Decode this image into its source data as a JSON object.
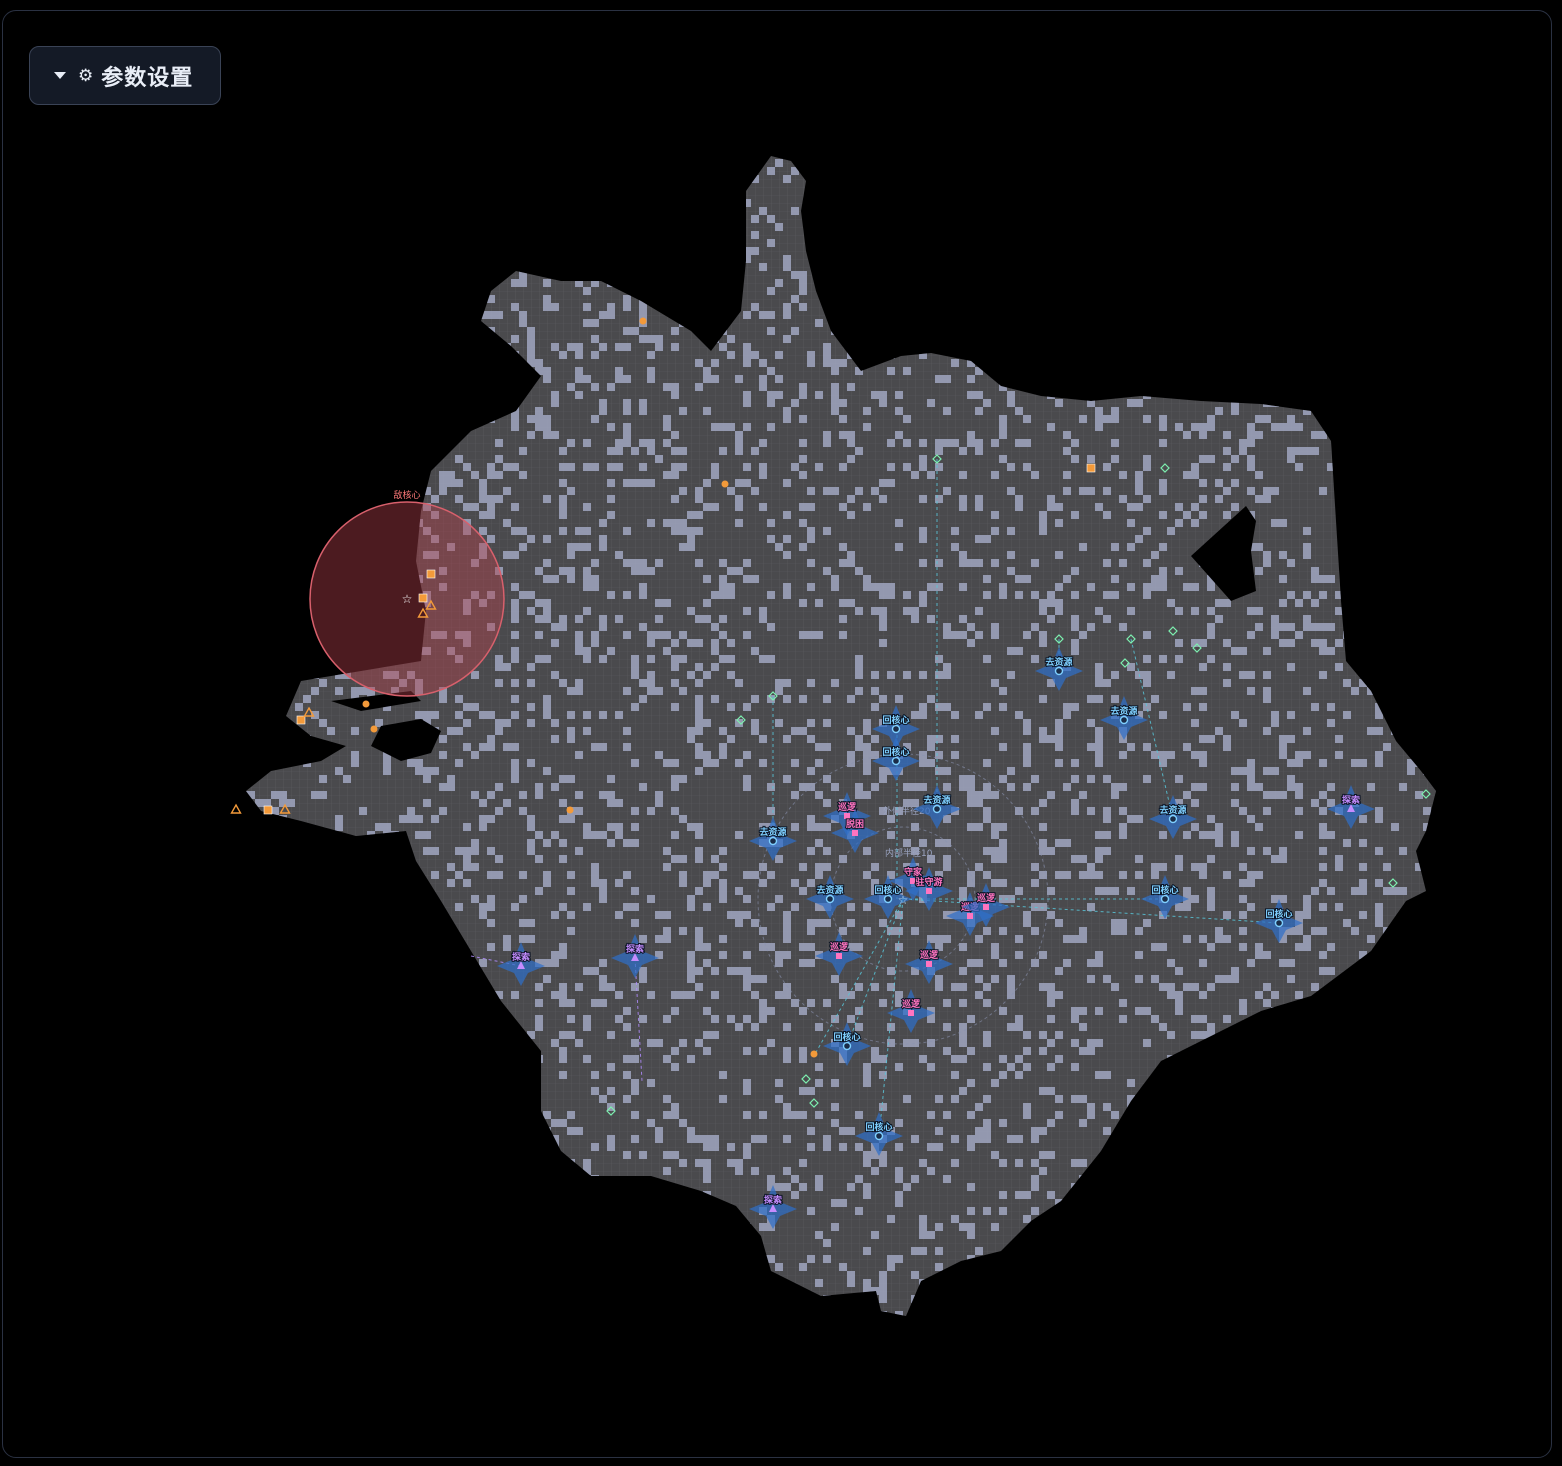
{
  "toolbar": {
    "settings_label": "参数设置",
    "gear_icon": "gear-icon",
    "caret_icon": "caret-down-icon"
  },
  "colors": {
    "background": "#000000",
    "floor": "#4a4a4d",
    "floor_grid": "#5c5c60",
    "wall_block": "#a4a9c4",
    "enemy_zone": "#b4404c",
    "friendly_glow": "#2f6fc8",
    "label_cyan": "#7fd0ff",
    "label_pink": "#ff74c0",
    "label_purple": "#c58cff",
    "resource_orange": "#f39a3a",
    "marker_green": "#7df0b0",
    "enemy_red": "#ff7a7a"
  },
  "map": {
    "enemy_core": {
      "label": "敌核心"
    },
    "zone_labels": {
      "outer": "外侧半径20",
      "inner": "内部半径10"
    },
    "units": [
      {
        "label": "回核心",
        "kind": "return"
      },
      {
        "label": "回核心",
        "kind": "return"
      },
      {
        "label": "去资源",
        "kind": "resource"
      },
      {
        "label": "去资源",
        "kind": "resource"
      },
      {
        "label": "去资源",
        "kind": "resource"
      },
      {
        "label": "去资源",
        "kind": "resource"
      },
      {
        "label": "去资源",
        "kind": "resource"
      },
      {
        "label": "去资源",
        "kind": "resource"
      },
      {
        "label": "巡逻",
        "kind": "patrol"
      },
      {
        "label": "脱困",
        "kind": "patrol"
      },
      {
        "label": "守家",
        "kind": "patrol"
      },
      {
        "label": "驻守游",
        "kind": "patrol"
      },
      {
        "label": "巡逻",
        "kind": "patrol"
      },
      {
        "label": "巡逻",
        "kind": "patrol"
      },
      {
        "label": "巡逻",
        "kind": "patrol"
      },
      {
        "label": "巡逻",
        "kind": "patrol"
      },
      {
        "label": "巡逻",
        "kind": "patrol"
      },
      {
        "label": "回核心",
        "kind": "return"
      },
      {
        "label": "回核心",
        "kind": "return"
      },
      {
        "label": "回核心",
        "kind": "return"
      },
      {
        "label": "回核心",
        "kind": "return"
      },
      {
        "label": "回核心",
        "kind": "return"
      },
      {
        "label": "探索",
        "kind": "explore"
      },
      {
        "label": "探索",
        "kind": "explore"
      },
      {
        "label": "探索",
        "kind": "explore"
      },
      {
        "label": "探索",
        "kind": "explore"
      }
    ]
  }
}
